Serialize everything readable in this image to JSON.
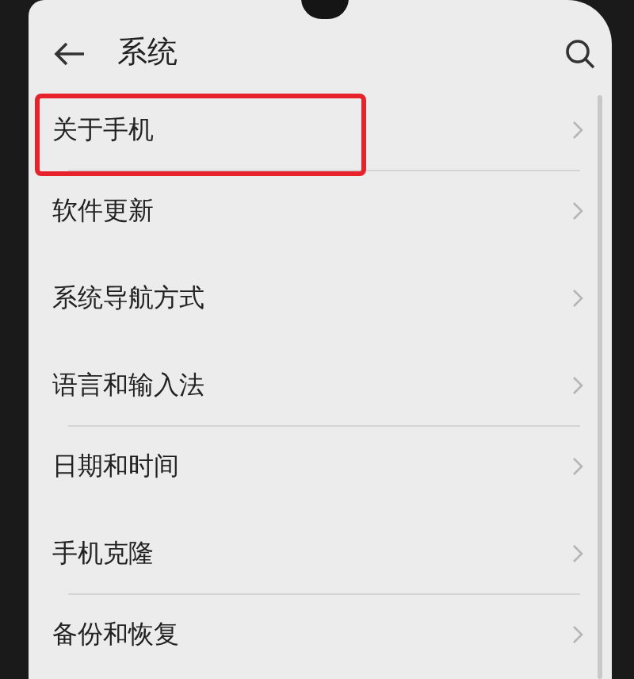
{
  "header": {
    "title": "系统"
  },
  "groups": [
    {
      "items": [
        {
          "label": "关于手机",
          "highlighted": true
        },
        {
          "label": "软件更新",
          "highlighted": false
        }
      ]
    },
    {
      "items": [
        {
          "label": "系统导航方式",
          "highlighted": false
        }
      ]
    },
    {
      "items": [
        {
          "label": "语言和输入法",
          "highlighted": false
        },
        {
          "label": "日期和时间",
          "highlighted": false
        }
      ]
    },
    {
      "items": [
        {
          "label": "手机克隆",
          "highlighted": false
        },
        {
          "label": "备份和恢复",
          "highlighted": false
        }
      ]
    }
  ]
}
